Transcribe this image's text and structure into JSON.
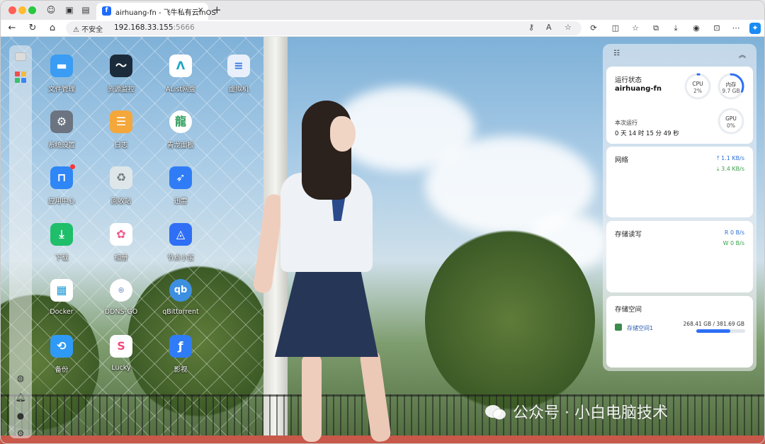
{
  "tab": {
    "title": "airhuang-fn - 飞牛私有云fnOS",
    "favicon": "fnos-icon"
  },
  "address_bar": {
    "security_label": "不安全",
    "url_host": "192.168.33.155",
    "url_port": ":5666"
  },
  "apps": [
    {
      "label": "文件管理",
      "icon": "folder-icon",
      "color": "#3a9cf3"
    },
    {
      "label": "资源监控",
      "icon": "monitor-icon",
      "color": "#1c2b3b"
    },
    {
      "label": "AList网盘",
      "icon": "alist-icon",
      "color": "#ffffff"
    },
    {
      "label": "虚拟机",
      "icon": "vm-icon",
      "color": "#e9f0fb"
    },
    {
      "label": "系统设置",
      "icon": "gear-icon",
      "color": "#6b7480"
    },
    {
      "label": "日志",
      "icon": "log-icon",
      "color": "#f4a73a"
    },
    {
      "label": "青龙面板",
      "icon": "qinglong-icon",
      "color": "#ffffff"
    },
    {
      "label": "应用中心",
      "icon": "store-icon",
      "color": "#2f86f6"
    },
    {
      "label": "回收站",
      "icon": "recycle-icon",
      "color": "#dfe6ea"
    },
    {
      "label": "迅雷",
      "icon": "thunder-icon",
      "color": "#2f7cf6"
    },
    {
      "label": "下载",
      "icon": "download-icon",
      "color": "#1fbe6a"
    },
    {
      "label": "相册",
      "icon": "photos-icon",
      "color": "#ffffff"
    },
    {
      "label": "节点小宝",
      "icon": "node-icon",
      "color": "#2f6ff5"
    },
    {
      "label": "Docker",
      "icon": "docker-icon",
      "color": "#ffffff"
    },
    {
      "label": "DDNS-GO",
      "icon": "ddns-icon",
      "color": "#1f4f9c"
    },
    {
      "label": "qBittorrent",
      "icon": "qbittorrent-icon",
      "color": "#3d8fe0"
    },
    {
      "label": "备份",
      "icon": "backup-icon",
      "color": "#2f9af5"
    },
    {
      "label": "Lucky",
      "icon": "lucky-icon",
      "color": "#ffffff"
    },
    {
      "label": "影视",
      "icon": "video-icon",
      "color": "#2f7cf6"
    }
  ],
  "status_card": {
    "title": "运行状态",
    "hostname": "airhuang-fn",
    "cpu": {
      "label": "CPU",
      "value": "2%",
      "percent": 2
    },
    "memory": {
      "label": "内存",
      "value": "9.7 GB",
      "percent": 32
    },
    "gpu": {
      "label": "GPU",
      "value": "0%",
      "percent": 0
    },
    "uptime_label": "本次运行",
    "uptime": "0 天 14 时 15 分 49 秒"
  },
  "network_card": {
    "title": "网络",
    "upload": "1.1 KB/s",
    "download": "3.4 KB/s"
  },
  "storage_io_card": {
    "title": "存储读写",
    "read": "R  0 B/s",
    "write": "W  0 B/s"
  },
  "storage_space_card": {
    "title": "存储空间",
    "volume_name": "存储空间1",
    "usage": "268.41 GB / 381.69 GB",
    "percent": 70
  },
  "watermark": {
    "text": "公众号 · 小白电脑技术"
  },
  "colors": {
    "accent": "#2f6ff5",
    "upload": "#2a6fd6",
    "download": "#3aa24a"
  }
}
